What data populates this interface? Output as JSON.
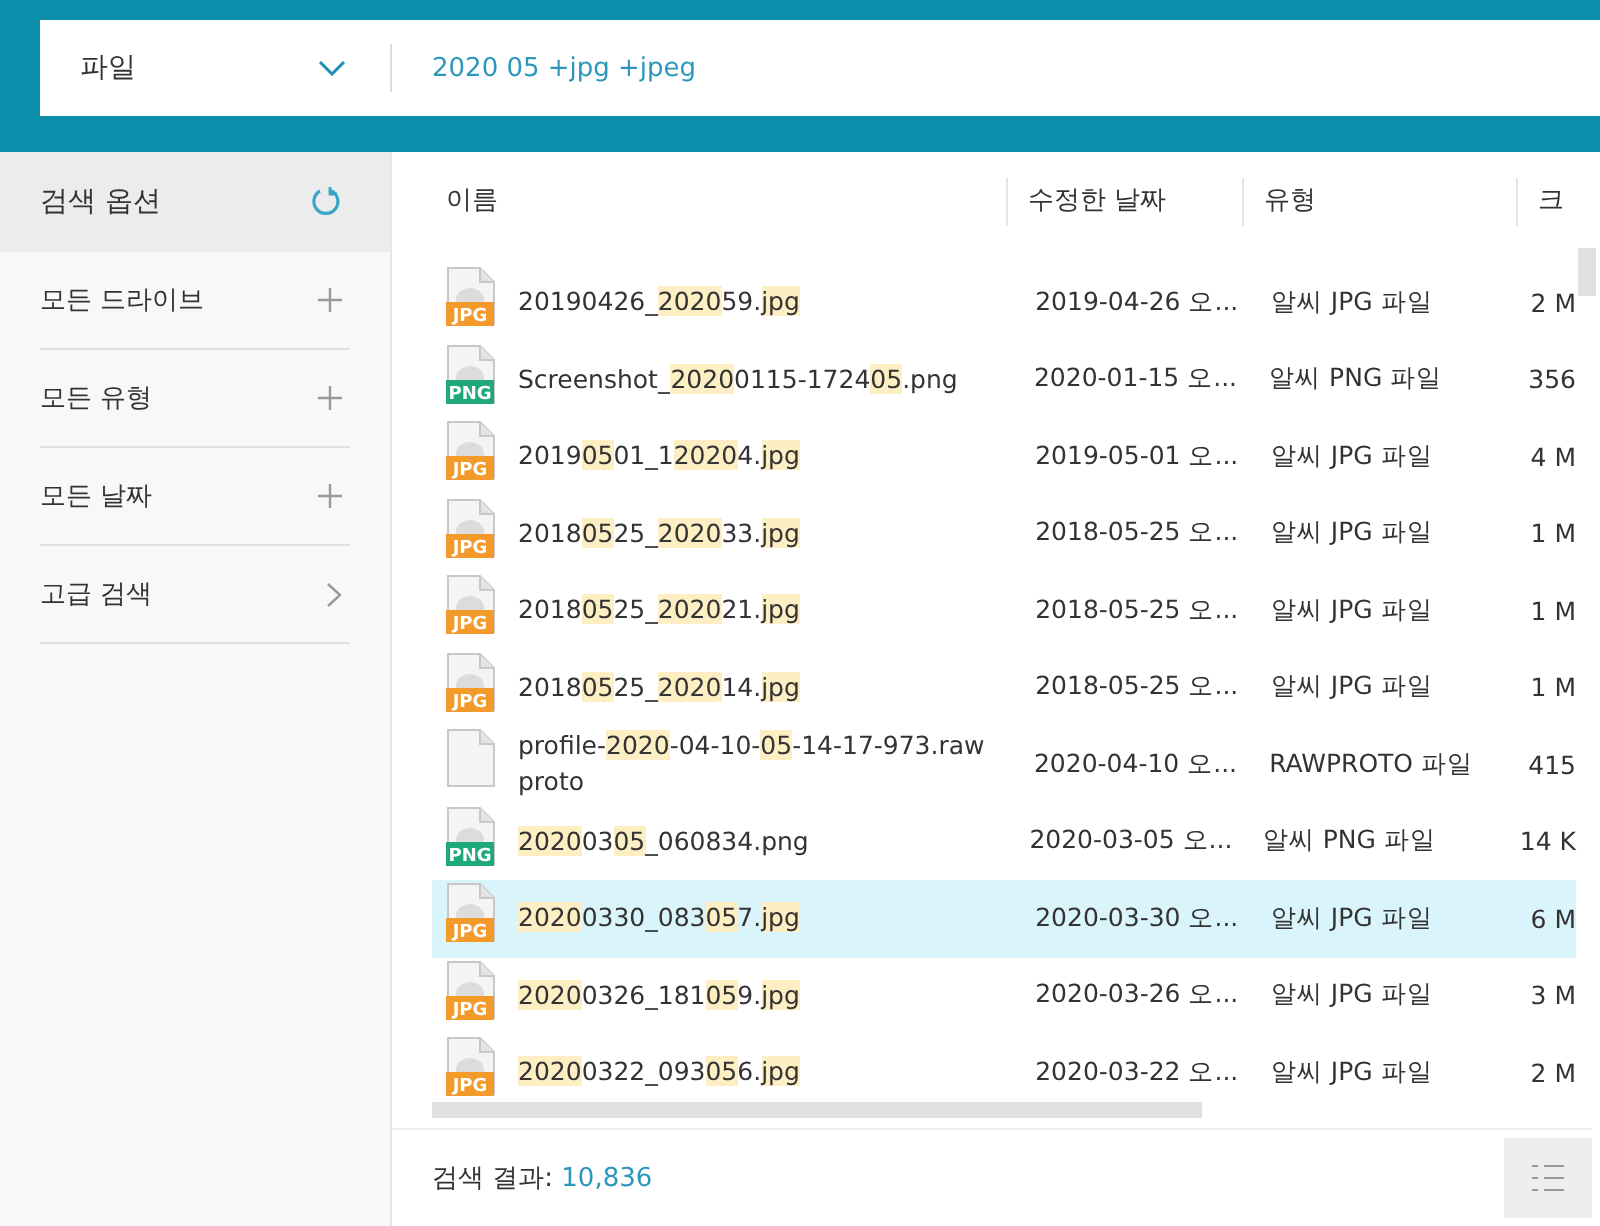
{
  "search_bar": {
    "scope": "파일",
    "query": "2020 05 +jpg +jpeg"
  },
  "sidebar": {
    "title": "검색 옵션",
    "items": [
      {
        "label": "모든 드라이브",
        "kind": "expand"
      },
      {
        "label": "모든 유형",
        "kind": "expand"
      },
      {
        "label": "모든 날짜",
        "kind": "expand"
      },
      {
        "label": "고급 검색",
        "kind": "navigate"
      }
    ]
  },
  "table": {
    "columns": [
      "이름",
      "수정한 날짜",
      "유형",
      "크"
    ],
    "rows": [
      {
        "kind": "jpg",
        "badge": "JPG",
        "name": [
          {
            "text": "20190426_",
            "highlight": false
          },
          {
            "text": "2020",
            "highlight": true
          },
          {
            "text": "59.",
            "highlight": false
          },
          {
            "text": "jpg",
            "highlight": true
          }
        ],
        "date": "2019-04-26 오...",
        "type": "알씨 JPG 파일",
        "size": "2 M",
        "selected": false
      },
      {
        "kind": "png",
        "badge": "PNG",
        "name": [
          {
            "text": "Screenshot_",
            "highlight": false
          },
          {
            "text": "2020",
            "highlight": true
          },
          {
            "text": "0115-1724",
            "highlight": false
          },
          {
            "text": "05",
            "highlight": true
          },
          {
            "text": ".png",
            "highlight": false
          }
        ],
        "date": "2020-01-15 오...",
        "type": "알씨 PNG 파일",
        "size": "356",
        "selected": false
      },
      {
        "kind": "jpg",
        "badge": "JPG",
        "name": [
          {
            "text": "2019",
            "highlight": false
          },
          {
            "text": "05",
            "highlight": true
          },
          {
            "text": "01_1",
            "highlight": false
          },
          {
            "text": "2020",
            "highlight": true
          },
          {
            "text": "4.",
            "highlight": false
          },
          {
            "text": "jpg",
            "highlight": true
          }
        ],
        "date": "2019-05-01 오...",
        "type": "알씨 JPG 파일",
        "size": "4 M",
        "selected": false
      },
      {
        "kind": "jpg",
        "badge": "JPG",
        "name": [
          {
            "text": "2018",
            "highlight": false
          },
          {
            "text": "05",
            "highlight": true
          },
          {
            "text": "25_",
            "highlight": false
          },
          {
            "text": "2020",
            "highlight": true
          },
          {
            "text": "33.",
            "highlight": false
          },
          {
            "text": "jpg",
            "highlight": true
          }
        ],
        "date": "2018-05-25 오...",
        "type": "알씨 JPG 파일",
        "size": "1 M",
        "selected": false
      },
      {
        "kind": "jpg",
        "badge": "JPG",
        "name": [
          {
            "text": "2018",
            "highlight": false
          },
          {
            "text": "05",
            "highlight": true
          },
          {
            "text": "25_",
            "highlight": false
          },
          {
            "text": "2020",
            "highlight": true
          },
          {
            "text": "21.",
            "highlight": false
          },
          {
            "text": "jpg",
            "highlight": true
          }
        ],
        "date": "2018-05-25 오...",
        "type": "알씨 JPG 파일",
        "size": "1 M",
        "selected": false
      },
      {
        "kind": "jpg",
        "badge": "JPG",
        "name": [
          {
            "text": "2018",
            "highlight": false
          },
          {
            "text": "05",
            "highlight": true
          },
          {
            "text": "25_",
            "highlight": false
          },
          {
            "text": "2020",
            "highlight": true
          },
          {
            "text": "14.",
            "highlight": false
          },
          {
            "text": "jpg",
            "highlight": true
          }
        ],
        "date": "2018-05-25 오...",
        "type": "알씨 JPG 파일",
        "size": "1 M",
        "selected": false
      },
      {
        "kind": "blank",
        "name": [
          {
            "text": "profile-",
            "highlight": false
          },
          {
            "text": "2020",
            "highlight": true
          },
          {
            "text": "-04-10-",
            "highlight": false
          },
          {
            "text": "05",
            "highlight": true
          },
          {
            "text": "-14-17-973.rawproto",
            "highlight": false
          }
        ],
        "date": "2020-04-10 오...",
        "type": "RAWPROTO 파일",
        "size": "415",
        "selected": false
      },
      {
        "kind": "png",
        "badge": "PNG",
        "name": [
          {
            "text": "2020",
            "highlight": true
          },
          {
            "text": "03",
            "highlight": false
          },
          {
            "text": "05",
            "highlight": true
          },
          {
            "text": "_060834.png",
            "highlight": false
          }
        ],
        "date": "2020-03-05 오...",
        "type": "알씨 PNG 파일",
        "size": "14 K",
        "selected": false
      },
      {
        "kind": "jpg",
        "badge": "JPG",
        "name": [
          {
            "text": "2020",
            "highlight": true
          },
          {
            "text": "0330_083",
            "highlight": false
          },
          {
            "text": "05",
            "highlight": true
          },
          {
            "text": "7.",
            "highlight": false
          },
          {
            "text": "jpg",
            "highlight": true
          }
        ],
        "date": "2020-03-30 오...",
        "type": "알씨 JPG 파일",
        "size": "6 M",
        "selected": true
      },
      {
        "kind": "jpg",
        "badge": "JPG",
        "name": [
          {
            "text": "2020",
            "highlight": true
          },
          {
            "text": "0326_181",
            "highlight": false
          },
          {
            "text": "05",
            "highlight": true
          },
          {
            "text": "9.",
            "highlight": false
          },
          {
            "text": "jpg",
            "highlight": true
          }
        ],
        "date": "2020-03-26 오...",
        "type": "알씨 JPG 파일",
        "size": "3 M",
        "selected": false
      },
      {
        "kind": "jpg",
        "badge": "JPG",
        "name": [
          {
            "text": "2020",
            "highlight": true
          },
          {
            "text": "0322_093",
            "highlight": false
          },
          {
            "text": "05",
            "highlight": true
          },
          {
            "text": "6.",
            "highlight": false
          },
          {
            "text": "jpg",
            "highlight": true
          }
        ],
        "date": "2020-03-22 오...",
        "type": "알씨 JPG 파일",
        "size": "2 M",
        "selected": false
      }
    ]
  },
  "status_bar": {
    "label": "검색 결과:",
    "count": "10,836"
  }
}
